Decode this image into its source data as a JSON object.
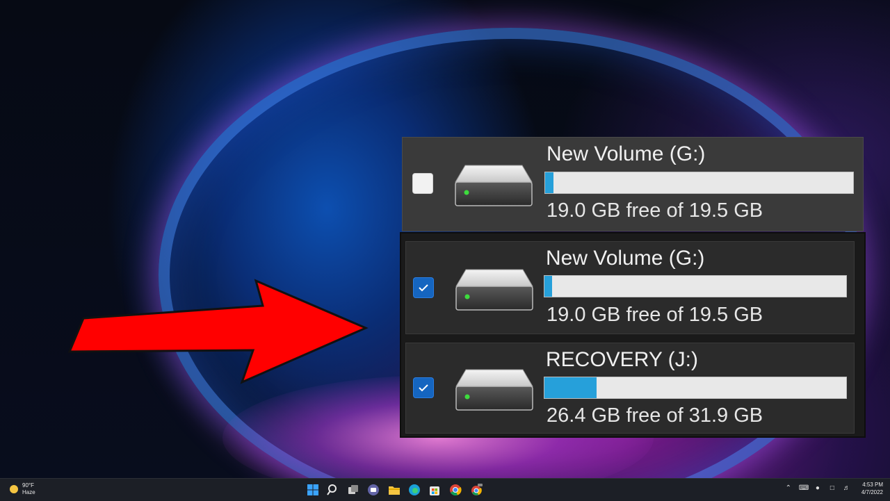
{
  "drives": [
    {
      "name": "New Volume (G:)",
      "free_text": "19.0 GB free of 19.5 GB",
      "used_fraction": 0.026,
      "checked": false
    },
    {
      "name": "New Volume (G:)",
      "free_text": "19.0 GB free of 19.5 GB",
      "used_fraction": 0.026,
      "checked": true
    },
    {
      "name": "RECOVERY (J:)",
      "free_text": "26.4 GB free of 31.9 GB",
      "used_fraction": 0.172,
      "checked": true
    }
  ],
  "colors": {
    "bar_fill": "#26a0da",
    "checkbox_checked": "#1565c0",
    "arrow": "#ff0000"
  },
  "taskbar": {
    "weather_temp": "90°F",
    "weather_desc": "Haze",
    "time": "4:53 PM",
    "date": "4/7/2022",
    "icons": [
      "windows-start-icon",
      "search-icon",
      "task-view-icon",
      "teams-chat-icon",
      "file-explorer-icon",
      "edge-icon",
      "microsoft-store-icon",
      "chrome-icon",
      "chrome-beta-icon"
    ]
  }
}
